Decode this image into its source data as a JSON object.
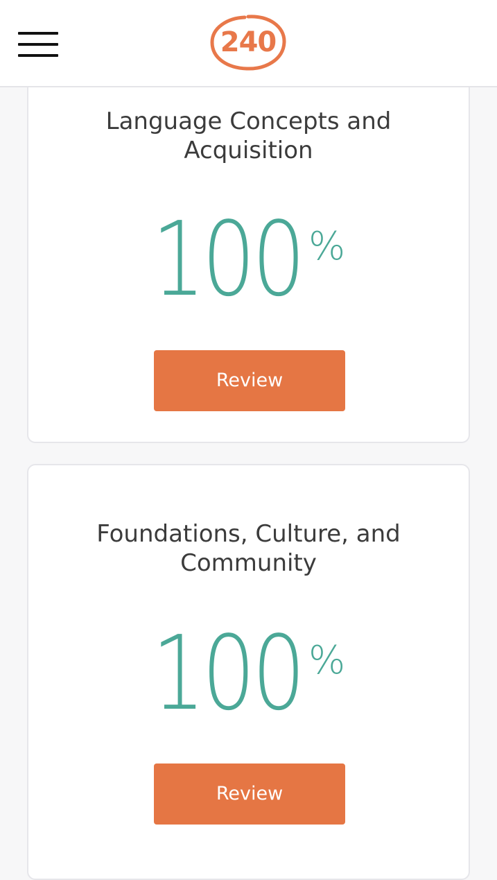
{
  "header": {
    "menu_icon": "hamburger-menu-icon",
    "logo_text": "240",
    "logo_color": "#e8784a"
  },
  "cards": [
    {
      "title_line1": "Language Concepts and",
      "title_line2": "Acquisition",
      "score_value": "100",
      "score_unit": "%",
      "review_label": "Review"
    },
    {
      "title_line1": "Foundations, Culture, and",
      "title_line2": "Community",
      "score_value": "100",
      "score_unit": "%",
      "review_label": "Review"
    }
  ],
  "colors": {
    "accent": "#e57644",
    "score": "#4ba897",
    "text": "#3b3b3b",
    "background": "#f7f7f8"
  }
}
